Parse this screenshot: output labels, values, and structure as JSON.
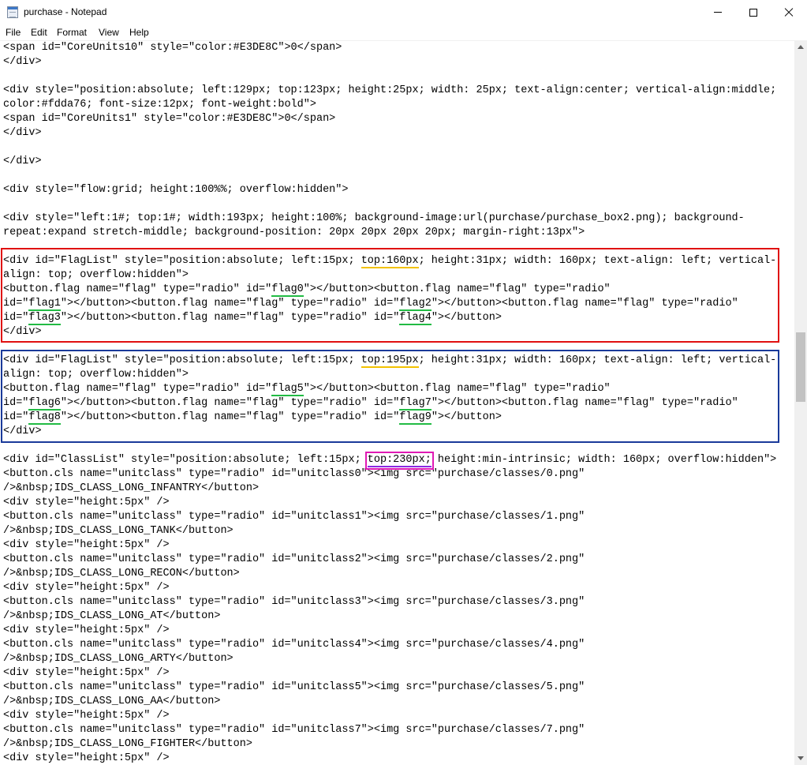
{
  "window": {
    "title": "purchase - Notepad",
    "icon": "notepad-icon",
    "controls": {
      "minimize": "minimize-icon",
      "maximize": "maximize-icon",
      "close": "close-icon"
    }
  },
  "menu": {
    "items": [
      {
        "label": "File"
      },
      {
        "label": "Edit"
      },
      {
        "label": "Format"
      },
      {
        "label": "View"
      },
      {
        "label": "Help"
      }
    ]
  },
  "annotation_colors": {
    "red_box": "#e01010",
    "blue_box": "#1a3a9a",
    "magenta_box": "#e01ab4",
    "yellow_underline": "#f3c200",
    "green_underline": "#22bb44",
    "purple_underline": "#8a2be2"
  },
  "editor": {
    "lines": [
      "<span id=\"CoreUnits10\" style=\"color:#E3DE8C\">0</span>",
      "</div>",
      "",
      "<div style=\"position:absolute; left:129px; top:123px; height:25px; width: 25px; text-align:center; vertical-align:middle;",
      "color:#fdda76; font-size:12px; font-weight:bold\">",
      "<span id=\"CoreUnits1\" style=\"color:#E3DE8C\">0</span>",
      "</div>",
      "",
      "</div>",
      "",
      "<div style=\"flow:grid; height:100%%; overflow:hidden\">",
      "",
      "<div style=\"left:1#; top:1#; width:193px; height:100%; background-image:url(purchase/purchase_box2.png); background-",
      "repeat:expand stretch-middle; background-position: 20px 20px 20px 20px; margin-right:13px\">",
      "",
      [
        "<div id=\"FlagList\" style=\"position:absolute; left:15px; ",
        {
          "u": "yellow",
          "t": "top:160px"
        },
        "; height:31px; width: 160px; text-align: left; vertical-"
      ],
      "align: top; overflow:hidden\">",
      [
        "<button.flag name=\"flag\" type=\"radio\" id=\"",
        {
          "u": "green",
          "t": "flag0"
        },
        "\"></button><button.flag name=\"flag\" type=\"radio\""
      ],
      [
        "id=\"",
        {
          "u": "green",
          "t": "flag1"
        },
        "\"></button><button.flag name=\"flag\" type=\"radio\" id=\"",
        {
          "u": "green",
          "t": "flag2"
        },
        "\"></button><button.flag name=\"flag\" type=\"radio\""
      ],
      [
        "id=\"",
        {
          "u": "green",
          "t": "flag3"
        },
        "\"></button><button.flag name=\"flag\" type=\"radio\" id=\"",
        {
          "u": "green",
          "t": "flag4"
        },
        "\"></button>"
      ],
      "</div>",
      "",
      [
        "<div id=\"FlagList\" style=\"position:absolute; left:15px; ",
        {
          "u": "yellow",
          "t": "top:195px"
        },
        "; height:31px; width: 160px; text-align: left; vertical-"
      ],
      "align: top; overflow:hidden\">",
      [
        "<button.flag name=\"flag\" type=\"radio\" id=\"",
        {
          "u": "green",
          "t": "flag5"
        },
        "\"></button><button.flag name=\"flag\" type=\"radio\""
      ],
      [
        "id=\"",
        {
          "u": "green",
          "t": "flag6"
        },
        "\"></button><button.flag name=\"flag\" type=\"radio\" id=\"",
        {
          "u": "green",
          "t": "flag7"
        },
        "\"></button><button.flag name=\"flag\" type=\"radio\""
      ],
      [
        "id=\"",
        {
          "u": "green",
          "t": "flag8"
        },
        "\"></button><button.flag name=\"flag\" type=\"radio\" id=\"",
        {
          "u": "green",
          "t": "flag9"
        },
        "\"></button>"
      ],
      "</div>",
      "",
      [
        "<div id=\"ClassList\" style=\"position:absolute; left:15px; ",
        {
          "u": "purple",
          "box": true,
          "t": "top:230px;"
        },
        " height:min-intrinsic; width: 160px; overflow:hidden\">"
      ],
      "<button.cls name=\"unitclass\" type=\"radio\" id=\"unitclass0\"><img src=\"purchase/classes/0.png\"",
      "/>&nbsp;IDS_CLASS_LONG_INFANTRY</button>",
      "<div style=\"height:5px\" />",
      "<button.cls name=\"unitclass\" type=\"radio\" id=\"unitclass1\"><img src=\"purchase/classes/1.png\"",
      "/>&nbsp;IDS_CLASS_LONG_TANK</button>",
      "<div style=\"height:5px\" />",
      "<button.cls name=\"unitclass\" type=\"radio\" id=\"unitclass2\"><img src=\"purchase/classes/2.png\"",
      "/>&nbsp;IDS_CLASS_LONG_RECON</button>",
      "<div style=\"height:5px\" />",
      "<button.cls name=\"unitclass\" type=\"radio\" id=\"unitclass3\"><img src=\"purchase/classes/3.png\"",
      "/>&nbsp;IDS_CLASS_LONG_AT</button>",
      "<div style=\"height:5px\" />",
      "<button.cls name=\"unitclass\" type=\"radio\" id=\"unitclass4\"><img src=\"purchase/classes/4.png\"",
      "/>&nbsp;IDS_CLASS_LONG_ARTY</button>",
      "<div style=\"height:5px\" />",
      "<button.cls name=\"unitclass\" type=\"radio\" id=\"unitclass5\"><img src=\"purchase/classes/5.png\"",
      "/>&nbsp;IDS_CLASS_LONG_AA</button>",
      "<div style=\"height:5px\" />",
      "<button.cls name=\"unitclass\" type=\"radio\" id=\"unitclass7\"><img src=\"purchase/classes/7.png\"",
      "/>&nbsp;IDS_CLASS_LONG_FIGHTER</button>",
      "<div style=\"height:5px\" />"
    ]
  }
}
